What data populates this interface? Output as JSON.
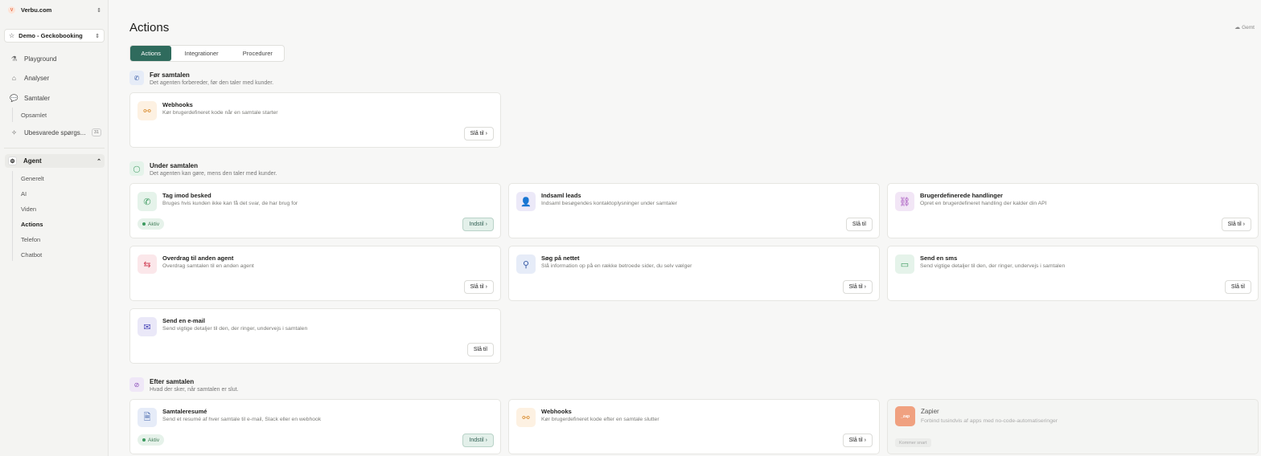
{
  "sidebar": {
    "org": {
      "name": "Verbu.com",
      "logo": "V"
    },
    "workspace": {
      "name": "Demo - Geckobooking"
    },
    "nav": [
      {
        "label": "Playground",
        "icon": "flask-icon"
      },
      {
        "label": "Analyser",
        "icon": "home-icon"
      },
      {
        "label": "Samtaler",
        "icon": "chat-icon"
      }
    ],
    "samtaler_sub": [
      "Opsamlet"
    ],
    "unanswered": {
      "label": "Ubesvarede spørgs...",
      "count": "31"
    },
    "agent": {
      "label": "Agent"
    },
    "agent_sub": [
      "Generelt",
      "AI",
      "Viden",
      "Actions",
      "Telefon",
      "Chatbot"
    ]
  },
  "header": {
    "title": "Actions",
    "saved": "Gemt"
  },
  "tabs": [
    "Actions",
    "Integrationer",
    "Procedurer"
  ],
  "sections": {
    "before": {
      "title": "Før samtalen",
      "desc": "Det agenten forbereder, før den taler med kunder."
    },
    "during": {
      "title": "Under samtalen",
      "desc": "Det agenten kan gøre, mens den taler med kunder."
    },
    "after": {
      "title": "Efter samtalen",
      "desc": "Hvad der sker, når samtalen er slut."
    }
  },
  "cards": {
    "webhooks_before": {
      "title": "Webhooks",
      "desc": "Kør brugerdefineret kode når en samtale starter",
      "button": "Slå til ›"
    },
    "message": {
      "title": "Tag imod besked",
      "desc": "Bruges hvis kunden ikke kan få det svar, de har brug for",
      "status": "Aktiv",
      "button": "Indstil ›"
    },
    "leads": {
      "title": "Indsaml leads",
      "desc": "Indsaml besøgendes kontaktoplysninger under samtaler",
      "button": "Slå til"
    },
    "custom": {
      "title": "Brugerdefinerede handlinger",
      "desc": "Opret en brugerdefineret handling der kalder din API",
      "button": "Slå til ›"
    },
    "handover": {
      "title": "Overdrag til anden agent",
      "desc": "Overdrag samtalen til en anden agent",
      "button": "Slå til ›"
    },
    "search": {
      "title": "Søg på nettet",
      "desc": "Slå information op på en række betroede sider, du selv vælger",
      "button": "Slå til ›"
    },
    "sms": {
      "title": "Send en sms",
      "desc": "Send vigtige detaljer til den, der ringer, undervejs i samtalen",
      "button": "Slå til"
    },
    "email": {
      "title": "Send en e-mail",
      "desc": "Send vigtige detaljer til den, der ringer, undervejs i samtalen",
      "button": "Slå til"
    },
    "summary": {
      "title": "Samtaleresumé",
      "desc": "Send et resumé af hver samtale til e-mail, Slack eller en webhook",
      "status": "Aktiv",
      "button": "Indstil ›"
    },
    "webhooks_after": {
      "title": "Webhooks",
      "desc": "Kør brugerdefineret kode efter en samtale slutter",
      "button": "Slå til ›"
    },
    "zapier": {
      "title": "Zapier",
      "desc": "Forbind tusindvis af apps med no-code-automatiseringer",
      "soon": "Kommer snart",
      "logo": "_zap"
    }
  },
  "colors": {
    "accent": "#2f6b5d",
    "active_status": "#3c9a5f"
  }
}
